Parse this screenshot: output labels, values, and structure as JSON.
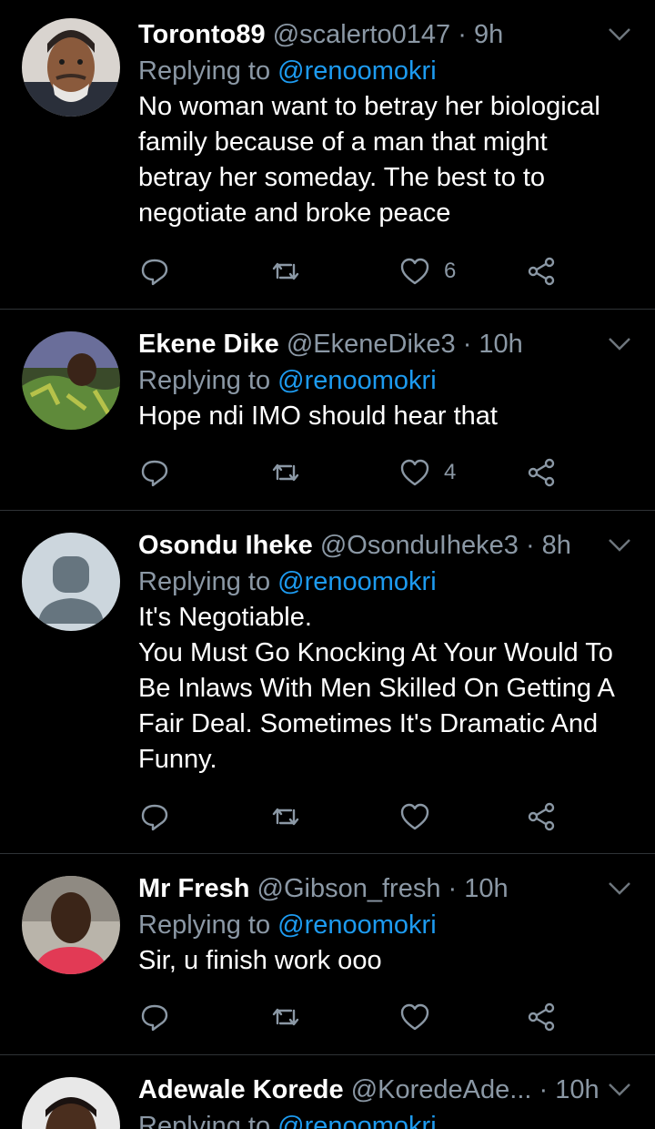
{
  "replying_prefix": "Replying to",
  "tweets": [
    {
      "name": "Toronto89",
      "meta": "@scalerto0147 · 9h",
      "reply_to": "@renoomokri",
      "text": "No woman want to betray her biological\nfamily because of a man that might\nbetray her someday. The best to to\nnegotiate and broke peace",
      "likes": "6",
      "avatar": "photo-man-mustache"
    },
    {
      "name": "Ekene Dike",
      "meta": "@EkeneDike3 · 10h",
      "reply_to": "@renoomokri",
      "text": "Hope ndi IMO should hear that",
      "likes": "4",
      "avatar": "photo-man-green-shirt"
    },
    {
      "name": "Osondu Iheke",
      "meta": "@OsonduIheke3 · 8h",
      "reply_to": "@renoomokri",
      "text": "It's Negotiable.\nYou Must Go Knocking At Your Would To\nBe Inlaws With Men Skilled On Getting A\nFair Deal. Sometimes It's Dramatic And\nFunny.",
      "likes": "",
      "avatar": "default-avatar"
    },
    {
      "name": "Mr Fresh",
      "meta": "@Gibson_fresh · 10h",
      "reply_to": "@renoomokri",
      "text": "Sir, u finish work ooo",
      "likes": "",
      "avatar": "photo-man-red-shirt"
    },
    {
      "name": "Adewale Korede",
      "meta": "@KoredeAde... · 10h",
      "reply_to": "@renoomokri",
      "text": "",
      "likes": "",
      "avatar": "photo-man-partial"
    }
  ],
  "colors": {
    "background": "#000000",
    "secondary_text": "#8b98a5",
    "link": "#1d9bf0",
    "divider": "#2f3336"
  },
  "icons": [
    "reply-icon",
    "retweet-icon",
    "like-icon",
    "share-icon",
    "chevron-down-icon"
  ]
}
